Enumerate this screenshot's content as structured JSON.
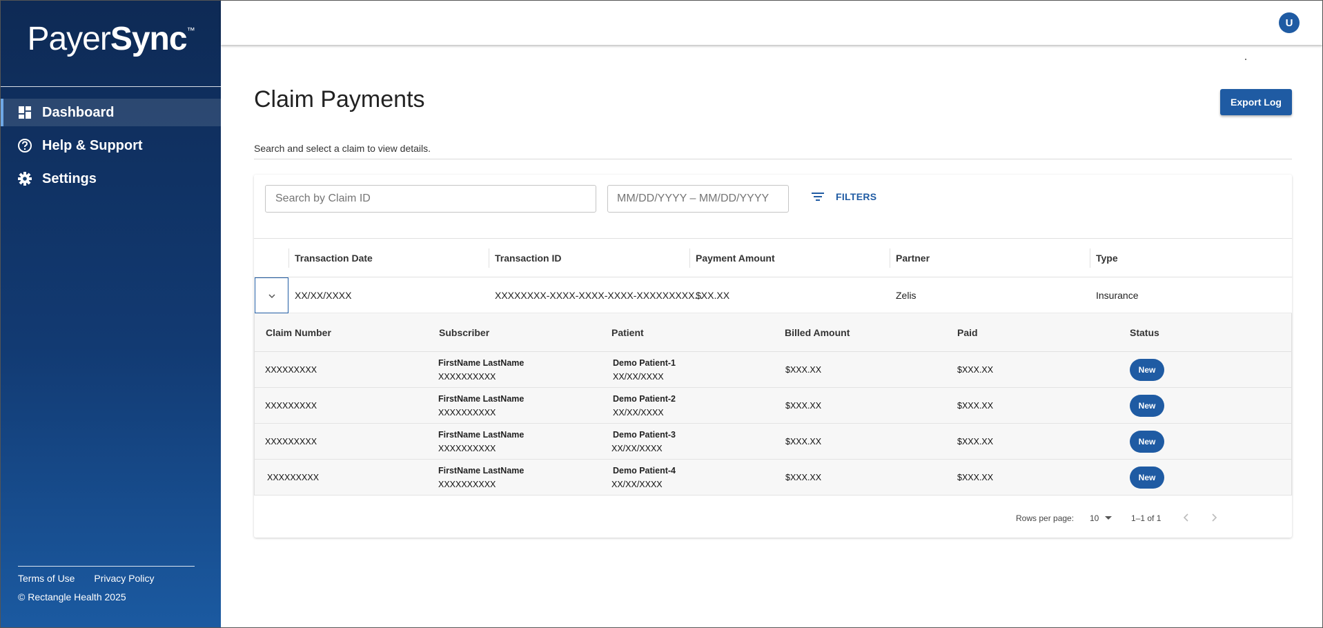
{
  "brand": {
    "light": "Payer",
    "bold": "Sync",
    "mark": "™"
  },
  "sidebar": {
    "items": [
      {
        "label": "Dashboard",
        "icon": "dashboard-icon",
        "active": true
      },
      {
        "label": "Help & Support",
        "icon": "help-circle-icon",
        "active": false
      },
      {
        "label": "Settings",
        "icon": "gear-icon",
        "active": false
      }
    ],
    "footer": {
      "terms": "Terms of Use",
      "privacy": "Privacy Policy",
      "copyright": "© Rectangle Health 2025"
    }
  },
  "header": {
    "avatar_initial": "U"
  },
  "page": {
    "title": "Claim Payments",
    "export_label": "Export Log",
    "subtitle": "Search and select a claim to view details."
  },
  "search": {
    "placeholder": "Search by Claim ID",
    "date_placeholder": "MM/DD/YYYY – MM/DD/YYYY",
    "filters_label": "FILTERS"
  },
  "table": {
    "columns": [
      "Transaction Date",
      "Transaction ID",
      "Payment Amount",
      "Partner",
      "Type"
    ],
    "rows": [
      {
        "date": "XX/XX/XXXX",
        "transaction_id": "XXXXXXXX-XXXX-XXXX-XXXX-XXXXXXXXX...",
        "amount": "$XX.XX",
        "partner": "Zelis",
        "type": "Insurance"
      }
    ]
  },
  "claims": {
    "columns": [
      "Claim Number",
      "Subscriber",
      "Patient",
      "Billed Amount",
      "Paid",
      "Status"
    ],
    "rows": [
      {
        "claim_number": "XXXXXXXXX",
        "subscriber_name": "FirstName LastName",
        "subscriber_id": "XXXXXXXXXX",
        "patient_name": "Demo Patient-1",
        "patient_dob": "XX/XX/XXXX",
        "billed": "$XXX.XX",
        "paid": "$XXX.XX",
        "status": "New"
      },
      {
        "claim_number": "XXXXXXXXX",
        "subscriber_name": "FirstName LastName",
        "subscriber_id": "XXXXXXXXXX",
        "patient_name": "Demo Patient-2",
        "patient_dob": "XX/XX/XXXX",
        "billed": "$XXX.XX",
        "paid": "$XXX.XX",
        "status": "New"
      },
      {
        "claim_number": "XXXXXXXXX",
        "subscriber_name": "FirstName LastName",
        "subscriber_id": "XXXXXXXXXX",
        "patient_name": "Demo Patient-3",
        "patient_dob": "XX/XX/XXXX",
        "billed": "$XXX.XX",
        "paid": "$XXX.XX",
        "status": "New"
      },
      {
        "claim_number": "XXXXXXXXX",
        "subscriber_name": "FirstName LastName",
        "subscriber_id": "XXXXXXXXXX",
        "patient_name": "Demo Patient-4",
        "patient_dob": "XX/XX/XXXX",
        "billed": "$XXX.XX",
        "paid": "$XXX.XX",
        "status": "New"
      }
    ]
  },
  "pagination": {
    "rows_per_page_label": "Rows per page:",
    "rows_per_page": "10",
    "range": "1–1 of 1"
  },
  "colors": {
    "primary": "#1f5ba3",
    "sidebar_top": "#0e2a55",
    "sidebar_bottom": "#1b5aa1"
  }
}
